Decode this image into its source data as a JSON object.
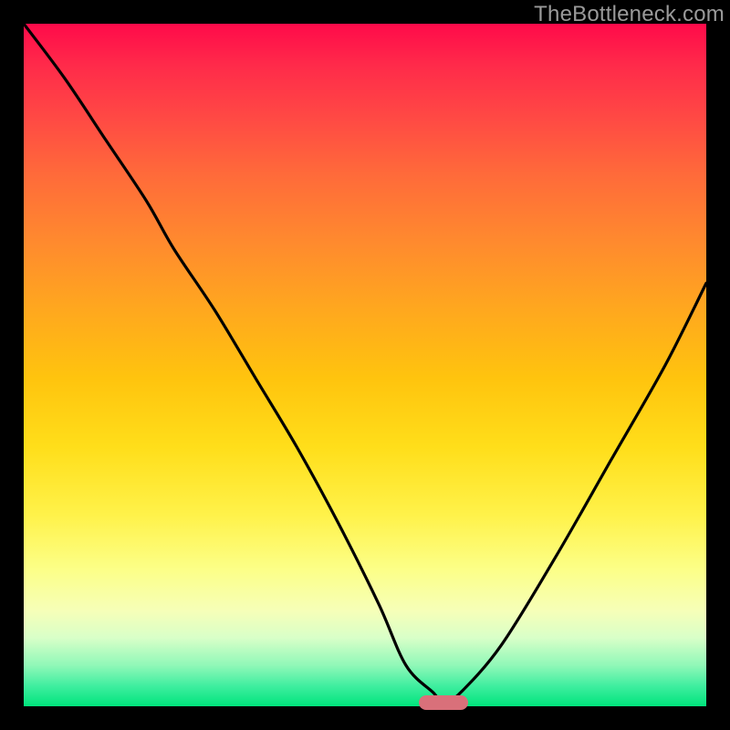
{
  "watermark": "TheBottleneck.com",
  "colors": {
    "curve": "#000000",
    "marker": "#d9707a"
  },
  "chart_data": {
    "type": "line",
    "title": "",
    "xlabel": "",
    "ylabel": "",
    "x_range": [
      0,
      100
    ],
    "y_range": [
      0,
      100
    ],
    "grid": false,
    "legend": false,
    "series": [
      {
        "name": "bottleneck-curve",
        "x": [
          0,
          6,
          12,
          18,
          22,
          28,
          34,
          40,
          46,
          52,
          56,
          60,
          61.5,
          64,
          70,
          78,
          86,
          94,
          100
        ],
        "y": [
          100,
          92,
          83,
          74,
          67,
          58,
          48,
          38,
          27,
          15,
          6,
          2,
          0.5,
          2,
          9,
          22,
          36,
          50,
          62
        ]
      }
    ],
    "marker": {
      "x": 61.5,
      "y": 0.5,
      "shape": "rounded-bar"
    }
  }
}
